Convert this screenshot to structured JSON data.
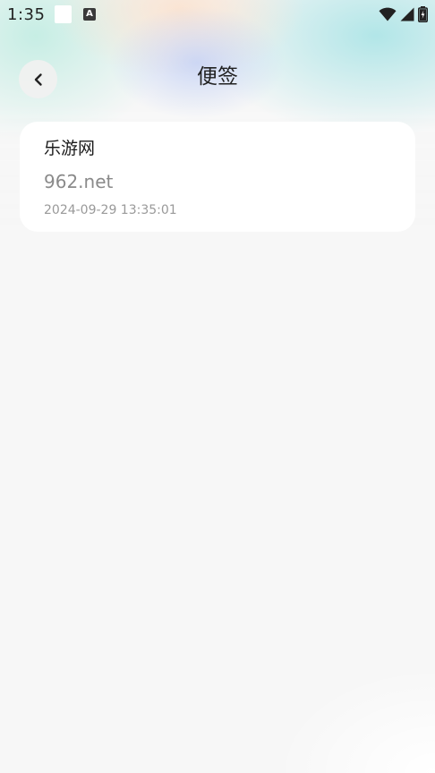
{
  "status_bar": {
    "time": "1:35",
    "a_icon_label": "A",
    "icons": [
      "white-square-icon",
      "a-notification-icon",
      "wifi-icon",
      "signal-icon",
      "battery-icon"
    ]
  },
  "header": {
    "title": "便签",
    "back_icon": "chevron-left-icon"
  },
  "notes": [
    {
      "title": "乐游网",
      "content": "962.net",
      "timestamp": "2024-09-29 13:35:01"
    }
  ],
  "colors": {
    "background": "#f7f7f7",
    "card": "#ffffff",
    "title_text": "#222222",
    "content_text": "#8a8a8a",
    "timestamp_text": "#999999"
  }
}
